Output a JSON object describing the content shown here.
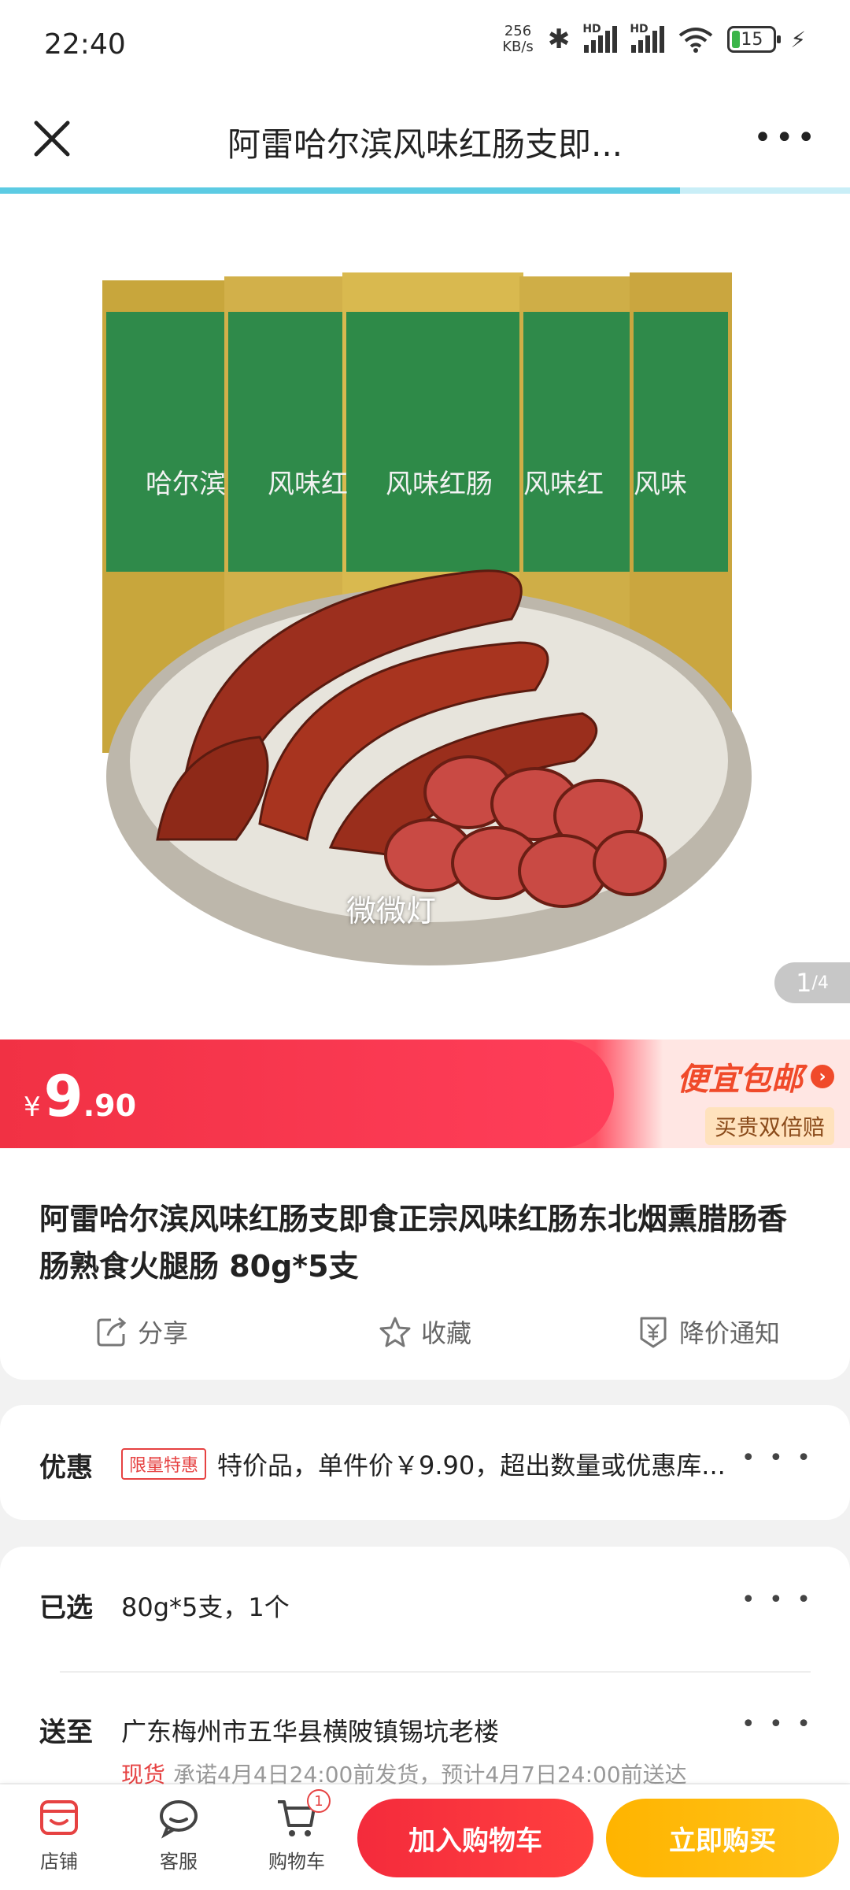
{
  "status_bar": {
    "time": "22:40",
    "net_speed_value": "256",
    "net_speed_unit": "KB/s",
    "signal_label": "HD",
    "battery": "15"
  },
  "nav": {
    "title": "阿雷哈尔滨风味红肠支即...",
    "close_icon": "close-icon",
    "more_icon": "more-icon"
  },
  "gallery": {
    "watermark": "微微灯",
    "current": "1",
    "total": "/4"
  },
  "price": {
    "symbol": "¥",
    "integer": "9",
    "decimal": ".90",
    "promo_main": "便宜包邮",
    "promo_sub": "买贵双倍赔"
  },
  "product": {
    "title": "阿雷哈尔滨风味红肠支即食正宗风味红肠东北烟熏腊肠香肠熟食火腿肠 80g*5支"
  },
  "actions": {
    "share": "分享",
    "favorite": "收藏",
    "price_alert": "降价通知"
  },
  "discount": {
    "label": "优惠",
    "tag": "限量特惠",
    "text": "特价品，单件价￥9.90，超出数量或优惠库..."
  },
  "selection": {
    "label": "已选",
    "value": "80g*5支，1个",
    "ship_label": "送至",
    "address": "广东梅州市五华县横陂镇锡坑老楼",
    "stock": "现货",
    "promise": "承诺4月4日24:00前发货，预计4月7日24:00前送达"
  },
  "bottom": {
    "shop": "店铺",
    "service": "客服",
    "cart": "购物车",
    "cart_count": "1",
    "add_to_cart": "加入购物车",
    "buy_now": "立即购买"
  },
  "colors": {
    "accent_red": "#f13144",
    "buy_yellow": "#ffb400",
    "progress_blue": "#5ccbe3"
  },
  "gallery_progress": 0.8
}
